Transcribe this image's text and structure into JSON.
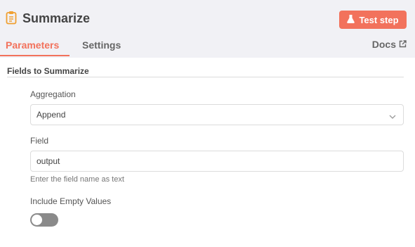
{
  "header": {
    "title": "Summarize",
    "title_icon": "clipboard-icon",
    "test_step_label": "Test step",
    "test_step_icon": "flask-icon"
  },
  "tabs": [
    {
      "label": "Parameters",
      "active": true
    },
    {
      "label": "Settings",
      "active": false
    }
  ],
  "docs": {
    "label": "Docs",
    "icon": "external-link-icon"
  },
  "section": {
    "title": "Fields to Summarize"
  },
  "aggregation": {
    "label": "Aggregation",
    "value": "Append"
  },
  "field": {
    "label": "Field",
    "value": "output",
    "hint": "Enter the field name as text"
  },
  "include_empty": {
    "label": "Include Empty Values",
    "enabled": false
  },
  "colors": {
    "accent": "#f2725c",
    "header_bg": "#f1f1f5",
    "toggle_off": "#8a8a8a"
  }
}
